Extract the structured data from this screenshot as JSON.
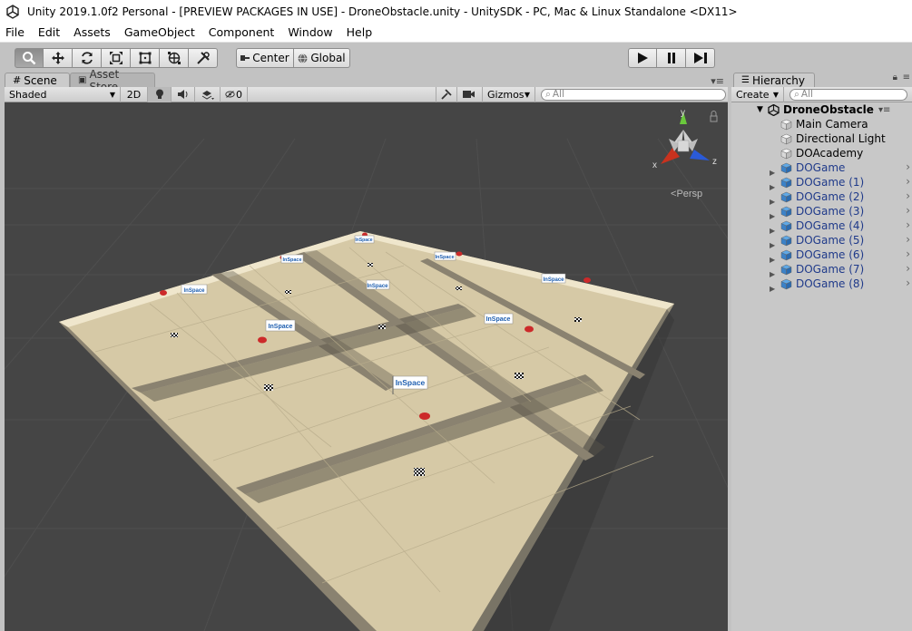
{
  "window": {
    "title": "Unity 2019.1.0f2 Personal - [PREVIEW PACKAGES IN USE] - DroneObstacle.unity - UnitySDK - PC, Mac & Linux Standalone <DX11>"
  },
  "menu": [
    "File",
    "Edit",
    "Assets",
    "GameObject",
    "Component",
    "Window",
    "Help"
  ],
  "toolbar": {
    "tools": [
      "hand-tool",
      "move-tool",
      "rotate-tool",
      "scale-tool",
      "rect-tool",
      "transform-tool",
      "custom-tool"
    ],
    "pivot_label": "Center",
    "space_label": "Global"
  },
  "scene_panel": {
    "tabs": [
      "Scene",
      "Asset Store"
    ],
    "shading_mode": "Shaded",
    "two_d_label": "2D",
    "hidden_count": "0",
    "gizmos_label": "Gizmos",
    "search_placeholder": "All",
    "persp_label": "Persp",
    "axis_labels": {
      "x": "x",
      "y": "y",
      "z": "z"
    },
    "flag_text": "InSpace"
  },
  "hierarchy": {
    "tab_label": "Hierarchy",
    "create_label": "Create",
    "search_placeholder": "All",
    "scene_name": "DroneObstacle",
    "items": [
      {
        "label": "Main Camera",
        "prefab": false,
        "expandable": false
      },
      {
        "label": "Directional Light",
        "prefab": false,
        "expandable": false
      },
      {
        "label": "DOAcademy",
        "prefab": false,
        "expandable": false
      },
      {
        "label": "DOGame",
        "prefab": true,
        "expandable": true
      },
      {
        "label": "DOGame (1)",
        "prefab": true,
        "expandable": true
      },
      {
        "label": "DOGame (2)",
        "prefab": true,
        "expandable": true
      },
      {
        "label": "DOGame (3)",
        "prefab": true,
        "expandable": true
      },
      {
        "label": "DOGame (4)",
        "prefab": true,
        "expandable": true
      },
      {
        "label": "DOGame (5)",
        "prefab": true,
        "expandable": true
      },
      {
        "label": "DOGame (6)",
        "prefab": true,
        "expandable": true
      },
      {
        "label": "DOGame (7)",
        "prefab": true,
        "expandable": true
      },
      {
        "label": "DOGame (8)",
        "prefab": true,
        "expandable": true
      }
    ]
  },
  "colors": {
    "viewport_bg": "#454545",
    "floor": "#d6c9a6",
    "wall": "#8a8270",
    "prefab_text": "#1f3a8a",
    "axis_x": "#c8321e",
    "axis_y": "#6ac83c",
    "axis_z": "#2a5ad8"
  }
}
